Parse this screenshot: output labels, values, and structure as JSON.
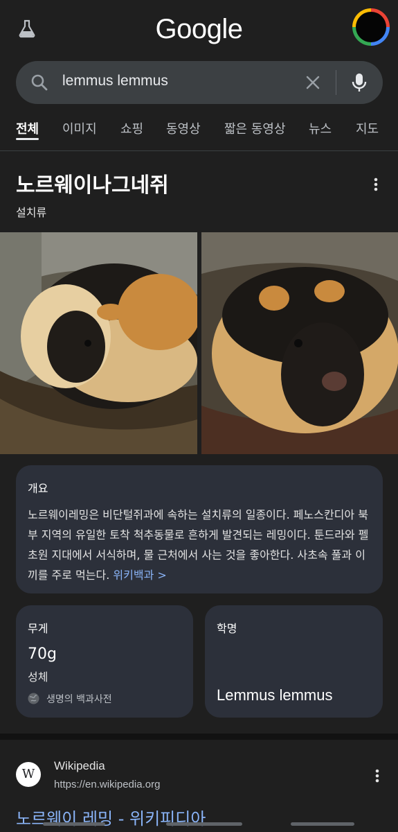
{
  "header": {
    "logo": "Google",
    "labs_icon": "flask-icon"
  },
  "search": {
    "query": "lemmus lemmus"
  },
  "tabs": [
    {
      "label": "전체",
      "active": true
    },
    {
      "label": "이미지"
    },
    {
      "label": "쇼핑"
    },
    {
      "label": "동영상"
    },
    {
      "label": "짧은 동영상"
    },
    {
      "label": "뉴스"
    },
    {
      "label": "지도"
    }
  ],
  "knowledge_panel": {
    "title": "노르웨이나그네쥐",
    "subtitle": "설치류",
    "overview": {
      "heading": "개요",
      "text": "노르웨이레밍은 비단털쥐과에 속하는 설치류의 일종이다. 페노스칸디아 북부 지역의 유일한 토착 척추동물로 흔하게 발견되는 레밍이다. 툰드라와 펠 초원 지대에서 서식하며, 물 근처에서 사는 것을 좋아한다. 사초속 풀과 이끼를 주로 먹는다.",
      "link": "위키백과 >"
    },
    "weight": {
      "heading": "무게",
      "value": "70g",
      "qualifier": "성체",
      "source": "생명의 백과사전"
    },
    "scientific_name": {
      "heading": "학명",
      "value": "Lemmus lemmus"
    }
  },
  "result": {
    "logo_letter": "W",
    "site": "Wikipedia",
    "url": "https://en.wikipedia.org",
    "title": "노르웨이 레밍 - 위키피디아"
  },
  "colors": {
    "background": "#1f1f1f",
    "card": "#2c303a",
    "link": "#8ab4f8",
    "search_bar": "#3c4043"
  }
}
